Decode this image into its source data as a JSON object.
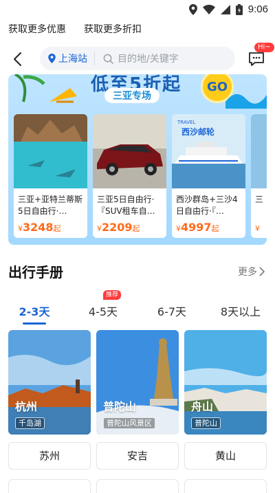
{
  "status_bar": {
    "time": "9:06"
  },
  "promo_links": [
    "获取更多优惠",
    "获取更多折扣"
  ],
  "nav": {
    "city": "上海站",
    "search_placeholder": "目的地/关键字",
    "message_badge": "Hi~"
  },
  "banner": {
    "headline": "低至5折起",
    "tag": "三亚专场",
    "go": "GO"
  },
  "products": [
    {
      "title": "三亚+亚特兰蒂斯5日自由行·…",
      "price": "3248",
      "currency": "¥",
      "suffix": "起"
    },
    {
      "title": "三亚5日自由行·『SUV租车自…",
      "price": "2209",
      "currency": "¥",
      "suffix": "起"
    },
    {
      "title": "西沙群岛+三沙4日自由行·『…",
      "price": "4997",
      "currency": "¥",
      "suffix": "起",
      "image_text": "西沙邮轮",
      "image_label": "TRAVEL"
    },
    {
      "title": "三「",
      "price": "",
      "currency": "¥",
      "suffix": ""
    }
  ],
  "section": {
    "title": "出行手册",
    "more": "更多"
  },
  "tabs": [
    {
      "label": "2-3天",
      "active": true
    },
    {
      "label": "4-5天",
      "badge": "推荐"
    },
    {
      "label": "6-7天"
    },
    {
      "label": "8天以上"
    }
  ],
  "destinations": [
    {
      "name": "杭州",
      "sub": "千岛湖"
    },
    {
      "name": "普陀山",
      "sub": "普陀山风景区"
    },
    {
      "name": "舟山",
      "sub": "普陀山"
    }
  ],
  "cities": [
    "苏州",
    "安吉",
    "黄山"
  ],
  "colors": {
    "accent": "#1a64d6",
    "price": "#ff6a1a",
    "badge": "#ff3b3b"
  }
}
